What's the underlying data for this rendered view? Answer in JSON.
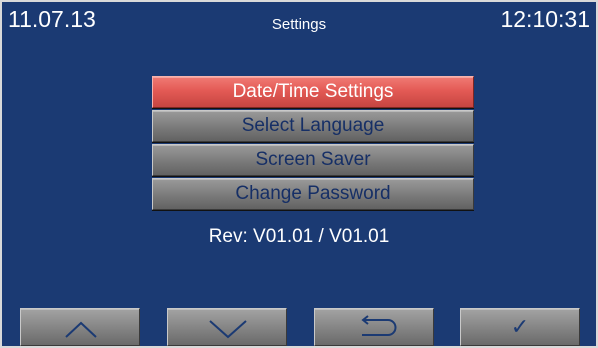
{
  "status_bar": {
    "date": "11.07.13",
    "title": "Settings",
    "time": "12:10:31"
  },
  "menu": {
    "items": [
      {
        "label": "Date/Time Settings",
        "selected": true
      },
      {
        "label": "Select Language",
        "selected": false
      },
      {
        "label": "Screen Saver",
        "selected": false
      },
      {
        "label": "Change Password",
        "selected": false
      }
    ]
  },
  "revision": "Rev: V01.01 / V01.01",
  "nav": {
    "up_icon": "arrow-up-icon",
    "down_icon": "arrow-down-icon",
    "back_icon": "return-icon",
    "ok_icon": "checkmark-icon",
    "ok_glyph": "✓"
  },
  "colors": {
    "background": "#1b3a73",
    "selected_item": "#e35a55",
    "item": "#7a7a7a",
    "item_text": "#162f66",
    "text": "#ffffff"
  }
}
